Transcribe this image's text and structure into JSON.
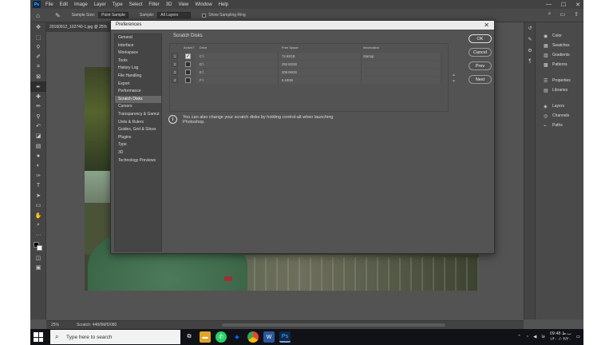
{
  "app": {
    "logo": "Ps",
    "menu": [
      "File",
      "Edit",
      "Image",
      "Layer",
      "Type",
      "Select",
      "Filter",
      "3D",
      "View",
      "Window",
      "Help"
    ],
    "window_controls": [
      "—",
      "☐",
      "✕"
    ]
  },
  "options_bar": {
    "sample_size_label": "Sample Size:",
    "sample_size_value": "Point Sample",
    "sample_label": "Sample:",
    "sample_value": "All Layers",
    "show_ring_label": "Show Sampling Ring",
    "right_icons": [
      "search-icon",
      "workspace-icon",
      "share-icon"
    ]
  },
  "document": {
    "tab_title": "20160912_102740-1.jpg @ 25%"
  },
  "tools": [
    "move-tool-icon",
    "marquee-tool-icon",
    "lasso-tool-icon",
    "quick-select-tool-icon",
    "crop-tool-icon",
    "frame-tool-icon",
    "eyedropper-tool-icon",
    "healing-brush-tool-icon",
    "brush-tool-icon",
    "clone-stamp-tool-icon",
    "history-brush-tool-icon",
    "eraser-tool-icon",
    "gradient-tool-icon",
    "blur-tool-icon",
    "dodge-tool-icon",
    "pen-tool-icon",
    "type-tool-icon",
    "path-select-tool-icon",
    "rectangle-tool-icon",
    "hand-tool-icon",
    "zoom-tool-icon",
    "more-tools-icon"
  ],
  "right_panels": [
    {
      "label": "Color",
      "icon": "color-icon"
    },
    {
      "label": "Swatches",
      "icon": "swatches-icon"
    },
    {
      "label": "Gradients",
      "icon": "gradients-icon"
    },
    {
      "label": "Patterns",
      "icon": "patterns-icon"
    },
    {
      "label": "Properties",
      "icon": "properties-icon"
    },
    {
      "label": "Libraries",
      "icon": "libraries-icon"
    },
    {
      "label": "Layers",
      "icon": "layers-icon"
    },
    {
      "label": "Channels",
      "icon": "channels-icon"
    },
    {
      "label": "Paths",
      "icon": "paths-icon"
    }
  ],
  "status_bar": {
    "zoom": "25%",
    "info": "Scratch: 448/0M/5/080"
  },
  "preferences": {
    "title": "Preferences",
    "categories": [
      "General",
      "Interface",
      "Workspace",
      "Tools",
      "History Log",
      "File Handling",
      "Export",
      "Performance",
      "Scratch Disks",
      "Cursors",
      "Transparency & Gamut",
      "Units & Rulers",
      "Guides, Grid & Slices",
      "Plugins",
      "Type",
      "3D",
      "Technology Previews"
    ],
    "selected_category": "Scratch Disks",
    "section_title": "Scratch Disks",
    "columns": {
      "active": "Active?",
      "drive": "Drive",
      "free_space": "Free Space",
      "information": "Information"
    },
    "disks": [
      {
        "num": "1",
        "active": true,
        "drive": "C:\\",
        "free": "74.93GB",
        "info": "Startup"
      },
      {
        "num": "2",
        "active": false,
        "drive": "D:\\",
        "free": "292.92GB",
        "info": ""
      },
      {
        "num": "3",
        "active": false,
        "drive": "E:\\",
        "free": "209.06GB",
        "info": ""
      },
      {
        "num": "4",
        "active": false,
        "drive": "F:\\",
        "free": "6.19GB",
        "info": ""
      }
    ],
    "info_text_line1": "You can also change your scratch disks by holding control-alt when launching",
    "info_text_line2": "Photoshop.",
    "buttons": {
      "ok": "OK",
      "cancel": "Cancel",
      "prev": "Prev",
      "next": "Next"
    }
  },
  "taskbar": {
    "search_placeholder": "Type here to search",
    "apps": [
      "task-view-icon",
      "file-explorer-icon",
      "whatsapp-icon",
      "dropbox-icon",
      "chrome-icon",
      "word-icon",
      "photoshop-icon"
    ],
    "time": "09:48 ب.ظ",
    "date": "۱۴۰۰/۰۴/۲۰",
    "lang": "فا"
  }
}
